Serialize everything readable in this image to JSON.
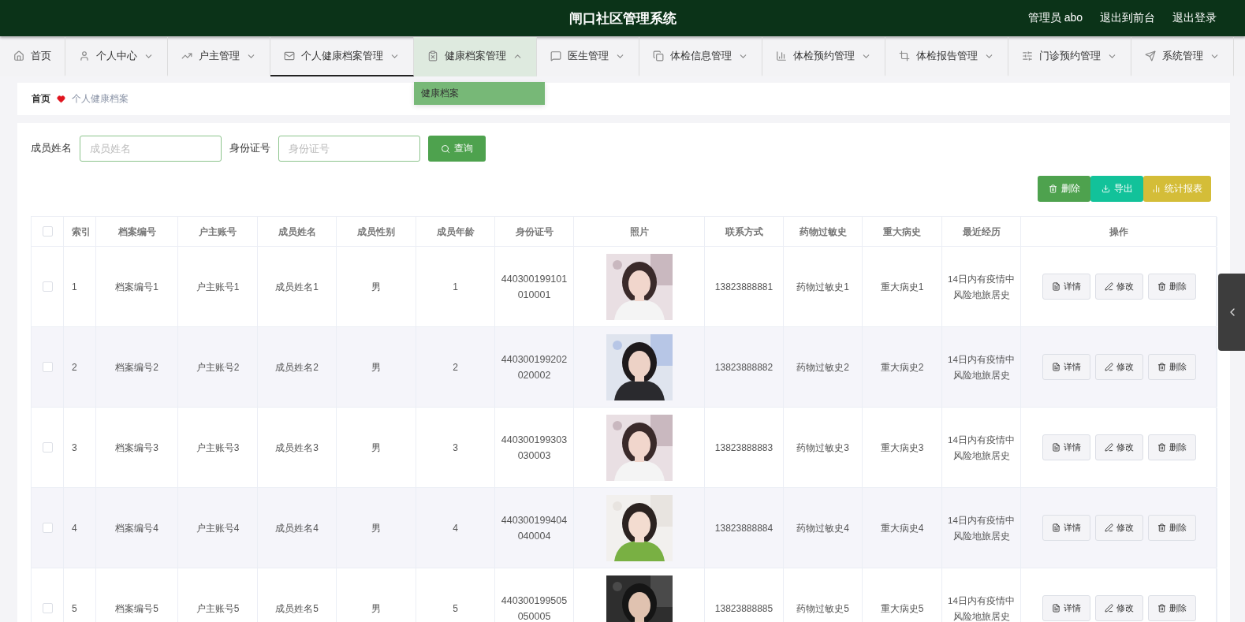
{
  "header": {
    "title": "闸口社区管理系统",
    "user": "管理员 abo",
    "links": [
      "退出到前台",
      "退出登录"
    ]
  },
  "nav": [
    {
      "label": "首页",
      "selected": false,
      "expanded": false,
      "has_menu": false
    },
    {
      "label": "个人中心",
      "selected": false,
      "expanded": false,
      "has_menu": true
    },
    {
      "label": "户主管理",
      "selected": false,
      "expanded": false,
      "has_menu": true
    },
    {
      "label": "个人健康档案管理",
      "selected": true,
      "expanded": false,
      "has_menu": true
    },
    {
      "label": "健康档案管理",
      "selected": false,
      "expanded": true,
      "has_menu": true,
      "submenu": [
        {
          "label": "健康档案",
          "hovered": true
        }
      ]
    },
    {
      "label": "医生管理",
      "selected": false,
      "expanded": false,
      "has_menu": true
    },
    {
      "label": "体检信息管理",
      "selected": false,
      "expanded": false,
      "has_menu": true
    },
    {
      "label": "体检预约管理",
      "selected": false,
      "expanded": false,
      "has_menu": true
    },
    {
      "label": "体检报告管理",
      "selected": false,
      "expanded": false,
      "has_menu": true
    },
    {
      "label": "门诊预约管理",
      "selected": false,
      "expanded": false,
      "has_menu": true
    },
    {
      "label": "系统管理",
      "selected": false,
      "expanded": false,
      "has_menu": true
    }
  ],
  "breadcrumb": [
    "首页",
    "个人健康档案"
  ],
  "search": {
    "fields": [
      {
        "label": "成员姓名",
        "placeholder": "成员姓名"
      },
      {
        "label": "身份证号",
        "placeholder": "身份证号"
      }
    ],
    "button": "查询"
  },
  "actions": [
    {
      "label": "删除",
      "kind": "delete"
    },
    {
      "label": "导出",
      "kind": "export"
    },
    {
      "label": "统计报表",
      "kind": "report"
    }
  ],
  "table": {
    "all_checked": false,
    "columns": [
      "索引",
      "档案编号",
      "户主账号",
      "成员姓名",
      "成员性别",
      "成员年龄",
      "身份证号",
      "照片",
      "联系方式",
      "药物过敏史",
      "重大病史",
      "最近经历",
      "操作"
    ],
    "rows": [
      {
        "checked": false,
        "cells": [
          "1",
          "档案编号1",
          "户主账号1",
          "成员姓名1",
          "男",
          "1",
          "440300199101010001"
        ],
        "photo": {
          "kind": "picture"
        },
        "cells2": [
          "13823888881",
          "药物过敏史1",
          "重大病史1",
          "14日内有疫情中风险地旅居史"
        ],
        "actions": [
          "详情",
          "修改",
          "删除"
        ]
      },
      {
        "checked": false,
        "cells": [
          "2",
          "档案编号2",
          "户主账号2",
          "成员姓名2",
          "男",
          "2",
          "440300199202020002"
        ],
        "photo": {
          "kind": "picture"
        },
        "cells2": [
          "13823888882",
          "药物过敏史2",
          "重大病史2",
          "14日内有疫情中风险地旅居史"
        ],
        "actions": [
          "详情",
          "修改",
          "删除"
        ]
      },
      {
        "checked": false,
        "cells": [
          "3",
          "档案编号3",
          "户主账号3",
          "成员姓名3",
          "男",
          "3",
          "440300199303030003"
        ],
        "photo": {
          "kind": "picture"
        },
        "cells2": [
          "13823888883",
          "药物过敏史3",
          "重大病史3",
          "14日内有疫情中风险地旅居史"
        ],
        "actions": [
          "详情",
          "修改",
          "删除"
        ]
      },
      {
        "checked": false,
        "cells": [
          "4",
          "档案编号4",
          "户主账号4",
          "成员姓名4",
          "男",
          "4",
          "440300199404040004"
        ],
        "photo": {
          "kind": "picture"
        },
        "cells2": [
          "13823888884",
          "药物过敏史4",
          "重大病史4",
          "14日内有疫情中风险地旅居史"
        ],
        "actions": [
          "详情",
          "修改",
          "删除"
        ]
      },
      {
        "checked": false,
        "cells": [
          "5",
          "档案编号5",
          "户主账号5",
          "成员姓名5",
          "男",
          "5",
          "440300199505050005"
        ],
        "photo": {
          "kind": "picture"
        },
        "cells2": [
          "13823888885",
          "药物过敏史5",
          "重大病史5",
          "14日内有疫情中风险地旅居史"
        ],
        "actions": [
          "详情",
          "修改",
          "删除"
        ]
      }
    ]
  }
}
